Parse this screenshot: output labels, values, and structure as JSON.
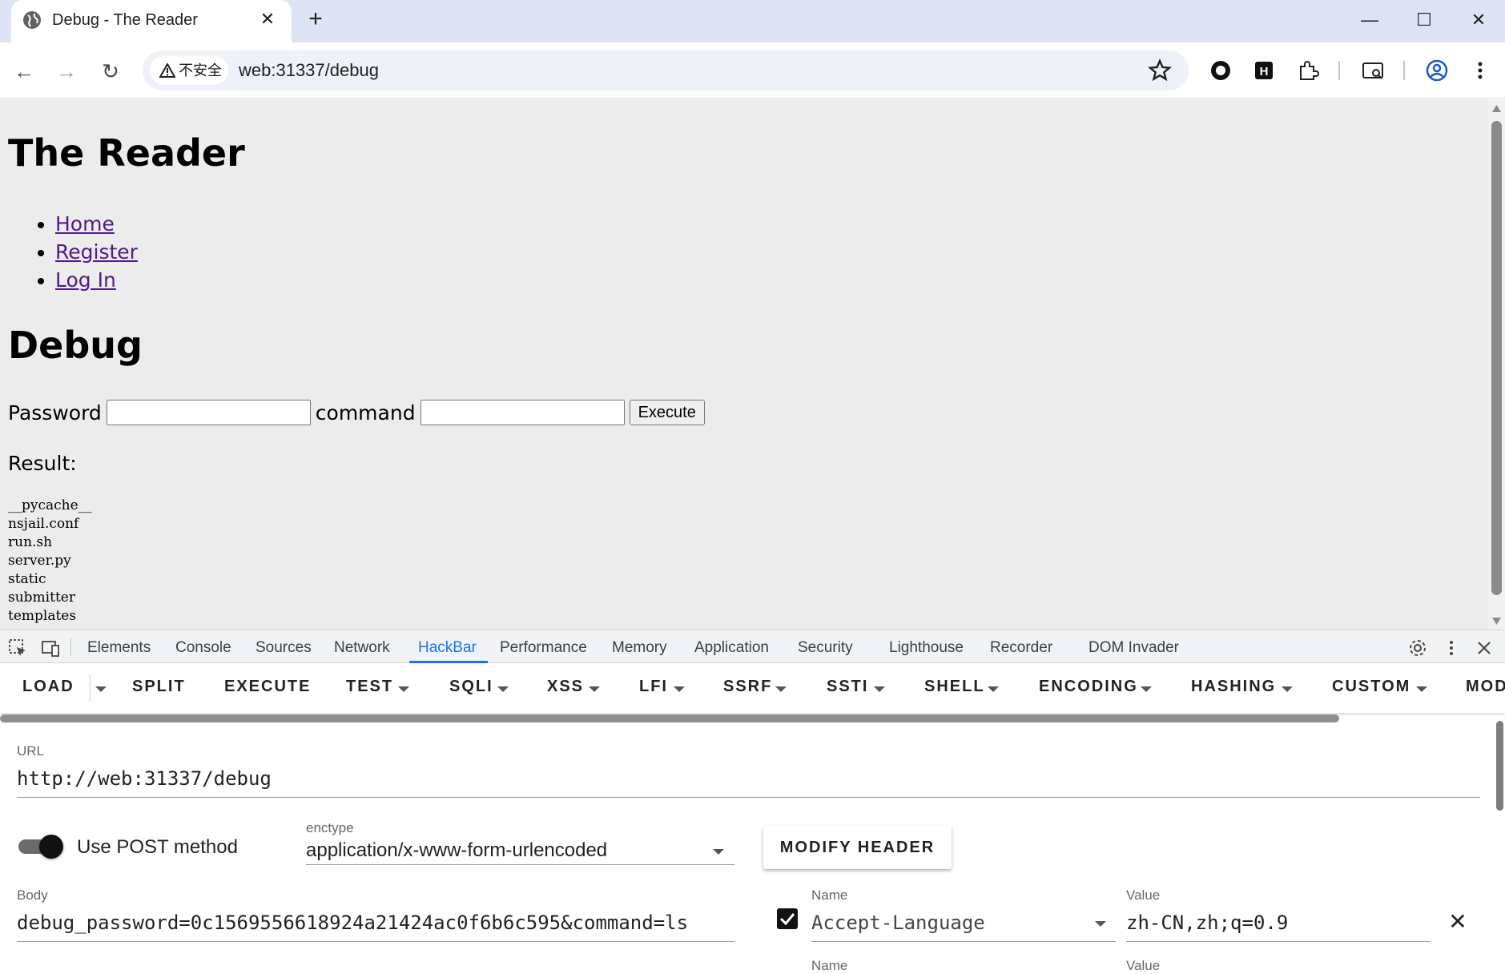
{
  "browser": {
    "tab_title": "Debug - The Reader",
    "insecure_label": "不安全",
    "url": "web:31337/debug"
  },
  "page": {
    "site_title": "The Reader",
    "nav": [
      "Home",
      "Register",
      "Log In"
    ],
    "heading": "Debug",
    "password_label": "Password",
    "command_label": "command",
    "execute_label": "Execute",
    "result_label": "Result:",
    "result_output": "__pycache__\nnsjail.conf\nrun.sh\nserver.py\nstatic\nsubmitter\ntemplates"
  },
  "devtools": {
    "tabs": [
      "Elements",
      "Console",
      "Sources",
      "Network",
      "HackBar",
      "Performance",
      "Memory",
      "Application",
      "Security",
      "Lighthouse",
      "Recorder",
      "DOM Invader"
    ],
    "active_tab": "HackBar",
    "hackbar": {
      "menu": [
        "LOAD",
        "SPLIT",
        "EXECUTE",
        "TEST",
        "SQLI",
        "XSS",
        "LFI",
        "SSRF",
        "SSTI",
        "SHELL",
        "ENCODING",
        "HASHING",
        "CUSTOM",
        "MOD"
      ],
      "url_label": "URL",
      "url_value": "http://web:31337/debug",
      "post_label": "Use POST method",
      "post_enabled": true,
      "enctype_label": "enctype",
      "enctype_value": "application/x-www-form-urlencoded",
      "modify_header_label": "MODIFY HEADER",
      "body_label": "Body",
      "body_value": "debug_password=0c1569556618924a21424ac0f6b6c595&command=ls",
      "header_name_label": "Name",
      "header_name_value": "Accept-Language",
      "header_value_label": "Value",
      "header_value_value": "zh-CN,zh;q=0.9",
      "header_enabled": true
    }
  },
  "colors": {
    "tabstrip_bg": "#dee3f5",
    "page_bg": "#ececec",
    "link": "#551a8b",
    "devtools_accent": "#1a73e8"
  }
}
